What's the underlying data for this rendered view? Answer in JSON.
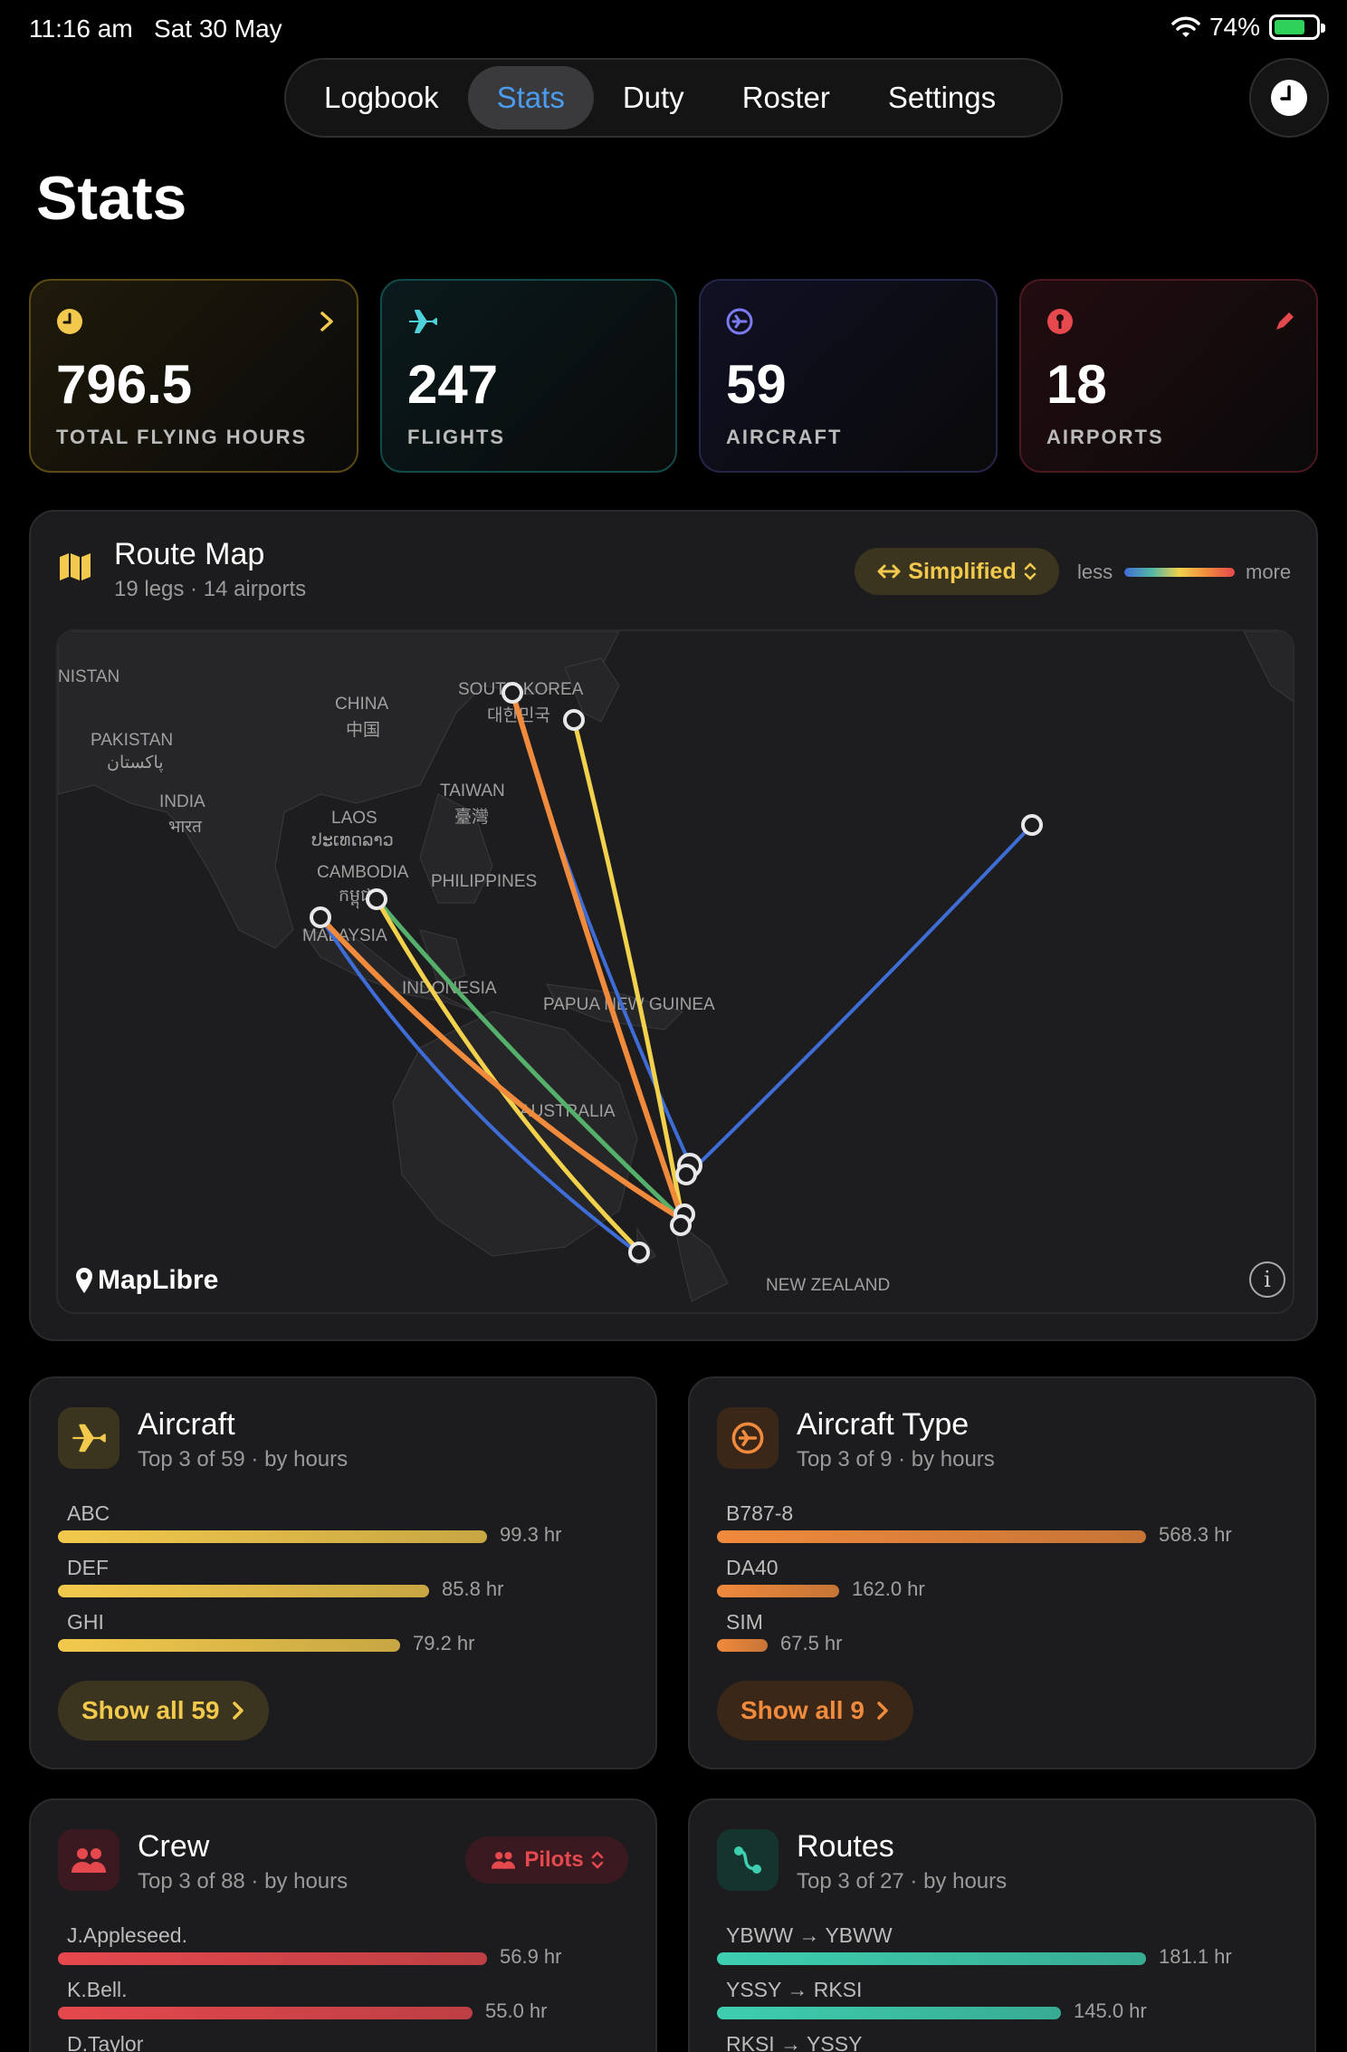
{
  "status_bar": {
    "time": "11:16 am",
    "date": "Sat 30 May",
    "battery": "74%",
    "battery_level": 0.74
  },
  "nav": {
    "tabs": [
      {
        "label": "Logbook",
        "active": false
      },
      {
        "label": "Stats",
        "active": true
      },
      {
        "label": "Duty",
        "active": false
      },
      {
        "label": "Roster",
        "active": false
      },
      {
        "label": "Settings",
        "active": false
      }
    ]
  },
  "page": {
    "title": "Stats"
  },
  "stats": [
    {
      "value": "796.5",
      "label": "TOTAL FLYING HOURS",
      "icon": "clock-icon",
      "accent": "#f2c94c"
    },
    {
      "value": "247",
      "label": "FLIGHTS",
      "icon": "airplane-icon",
      "accent": "#4fd1d9"
    },
    {
      "value": "59",
      "label": "AIRCRAFT",
      "icon": "airplane-circle-icon",
      "accent": "#7b7bf0"
    },
    {
      "value": "18",
      "label": "AIRPORTS",
      "icon": "pin-icon",
      "accent": "#e5484d"
    }
  ],
  "route_map": {
    "title": "Route Map",
    "subtitle": "19 legs · 14 airports",
    "mode": "Simplified",
    "legend_less": "less",
    "legend_more": "more",
    "attribution": "MapLibre",
    "labels": {
      "nistan": "NISTAN",
      "china": "CHINA",
      "china_local": "中国",
      "pakistan": "PAKISTAN",
      "pakistan_local": "پاکستان",
      "india": "INDIA",
      "india_local": "भारत",
      "south_korea": "SOUTH KOREA",
      "south_korea_local": "대한민국",
      "taiwan": "TAIWAN",
      "taiwan_local": "臺灣",
      "laos": "LAOS",
      "laos_local": "ປະເທດລາວ",
      "cambodia": "CAMBODIA",
      "cambodia_local": "កម្ពុជា",
      "philippines": "PHILIPPINES",
      "malaysia": "MALAYSIA",
      "indonesia": "INDONESIA",
      "png": "PAPUA NEW GUINEA",
      "australia": "AUSTRALIA",
      "nz": "NEW ZEALAND"
    },
    "colors": {
      "low": "#3f6dd8",
      "mid_low": "#54b06a",
      "mid": "#f2d14c",
      "high": "#f08a3c"
    }
  },
  "aircraft": {
    "title": "Aircraft",
    "subtitle": "Top 3 of 59 · by hours",
    "items": [
      {
        "name": "ABC",
        "value": "99.3 hr",
        "hours": 99.3
      },
      {
        "name": "DEF",
        "value": "85.8 hr",
        "hours": 85.8
      },
      {
        "name": "GHI",
        "value": "79.2 hr",
        "hours": 79.2
      }
    ],
    "show_all": "Show all 59",
    "color": "#f2c94c"
  },
  "aircraft_type": {
    "title": "Aircraft Type",
    "subtitle": "Top 3 of 9 · by hours",
    "items": [
      {
        "name": "B787-8",
        "value": "568.3 hr",
        "hours": 568.3
      },
      {
        "name": "DA40",
        "value": "162.0 hr",
        "hours": 162.0
      },
      {
        "name": "SIM",
        "value": "67.5 hr",
        "hours": 67.5
      }
    ],
    "show_all": "Show all 9",
    "color": "#f08a3c"
  },
  "crew": {
    "title": "Crew",
    "subtitle": "Top 3 of 88 · by hours",
    "filter": "Pilots",
    "items": [
      {
        "name": "J.Appleseed.",
        "value": "56.9 hr",
        "hours": 56.9
      },
      {
        "name": "K.Bell.",
        "value": "55.0 hr",
        "hours": 55.0
      },
      {
        "name": "D.Taylor",
        "value": "",
        "hours": 0
      }
    ],
    "color": "#e5484d"
  },
  "routes": {
    "title": "Routes",
    "subtitle": "Top 3 of 27 · by hours",
    "items": [
      {
        "name": "YBWW → YBWW",
        "value": "181.1 hr",
        "hours": 181.1
      },
      {
        "name": "YSSY → RKSI",
        "value": "145.0 hr",
        "hours": 145.0
      },
      {
        "name": "RKSI → YSSY",
        "value": "",
        "hours": 0
      }
    ],
    "color": "#3ecfb0"
  }
}
